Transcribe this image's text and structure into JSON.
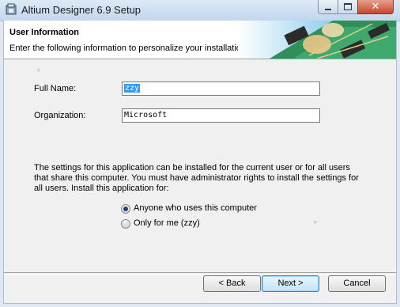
{
  "window": {
    "title": "Altium Designer 6.9 Setup",
    "app_icon": "installer-icon"
  },
  "banner": {
    "title": "User Information",
    "subtitle": "Enter the following information to personalize your installation."
  },
  "form": {
    "full_name_label": "Full Name:",
    "full_name_value": "zzy",
    "organization_label": "Organization:",
    "organization_value": "Microsoft"
  },
  "settings": {
    "description": "The settings for this application can be installed for the current user or for all users that share this computer. You must have administrator rights to install the settings for all users. Install this application for:",
    "options": [
      {
        "label": "Anyone who uses this computer",
        "selected": true
      },
      {
        "label": "Only for me (zzy)",
        "selected": false
      }
    ]
  },
  "buttons": {
    "back": "< Back",
    "next": "Next >",
    "cancel": "Cancel"
  },
  "colors": {
    "accent": "#3399ff",
    "close": "#c6462c"
  }
}
